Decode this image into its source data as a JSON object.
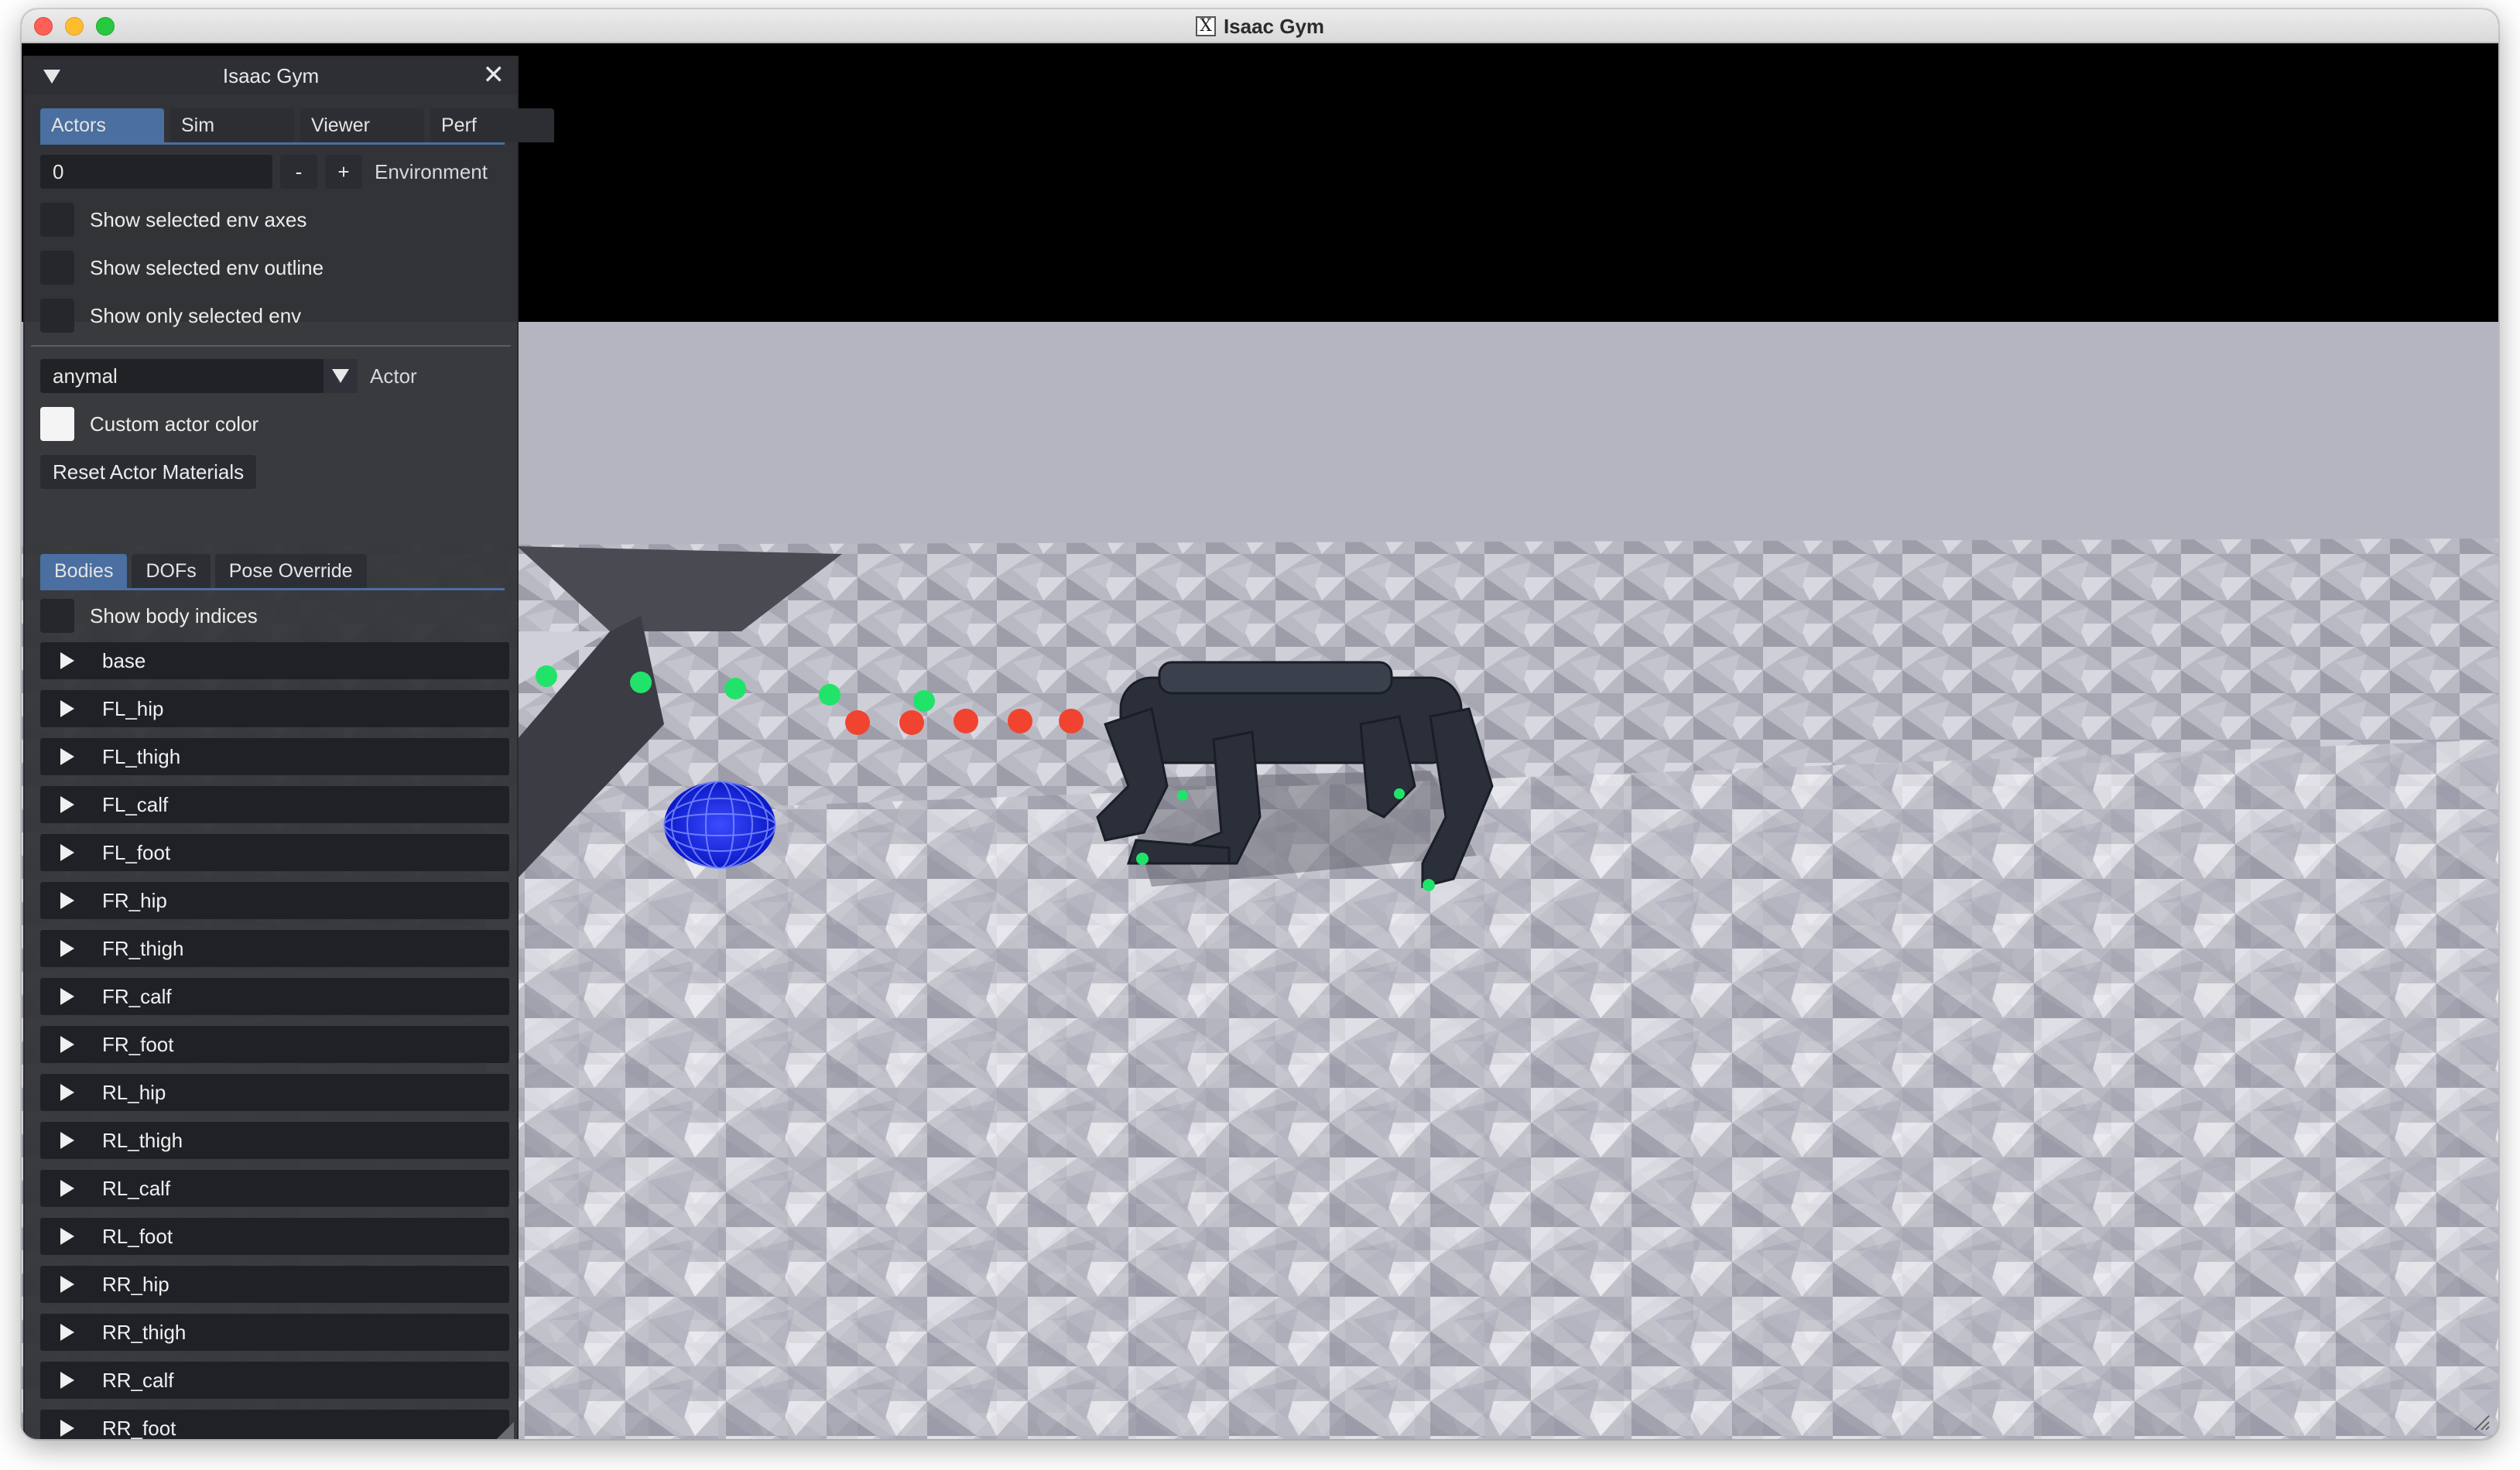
{
  "window": {
    "title": "Isaac Gym"
  },
  "panel": {
    "title": "Isaac Gym",
    "tabs": [
      "Actors",
      "Sim",
      "Viewer",
      "Perf"
    ],
    "active_tab": "Actors",
    "environment": {
      "value": "0",
      "minus": "-",
      "plus": "+",
      "label": "Environment"
    },
    "checkboxes": [
      {
        "label": "Show selected env axes",
        "checked": false
      },
      {
        "label": "Show selected env outline",
        "checked": false
      },
      {
        "label": "Show only selected env",
        "checked": false
      }
    ],
    "actor": {
      "selected": "anymal",
      "label": "Actor"
    },
    "custom_color_label": "Custom actor color",
    "reset_button": "Reset Actor Materials",
    "subtabs": [
      "Bodies",
      "DOFs",
      "Pose Override"
    ],
    "active_subtab": "Bodies",
    "show_body_indices": "Show body indices",
    "bodies": [
      "base",
      "FL_hip",
      "FL_thigh",
      "FL_calf",
      "FL_foot",
      "FR_hip",
      "FR_thigh",
      "FR_calf",
      "FR_foot",
      "RL_hip",
      "RL_thigh",
      "RL_calf",
      "RL_foot",
      "RR_hip",
      "RR_thigh",
      "RR_calf",
      "RR_foot"
    ]
  },
  "colors": {
    "accent_tab": "#4a6fa0",
    "green_marker": "#22e36a",
    "red_marker": "#f04430",
    "goal_sphere": "#1020e0",
    "robot": "#2a2f3a"
  },
  "scene": {
    "icons": [
      "collapse-triangle-icon",
      "close-icon",
      "dropdown-arrow-icon",
      "expand-arrow-icon"
    ]
  }
}
